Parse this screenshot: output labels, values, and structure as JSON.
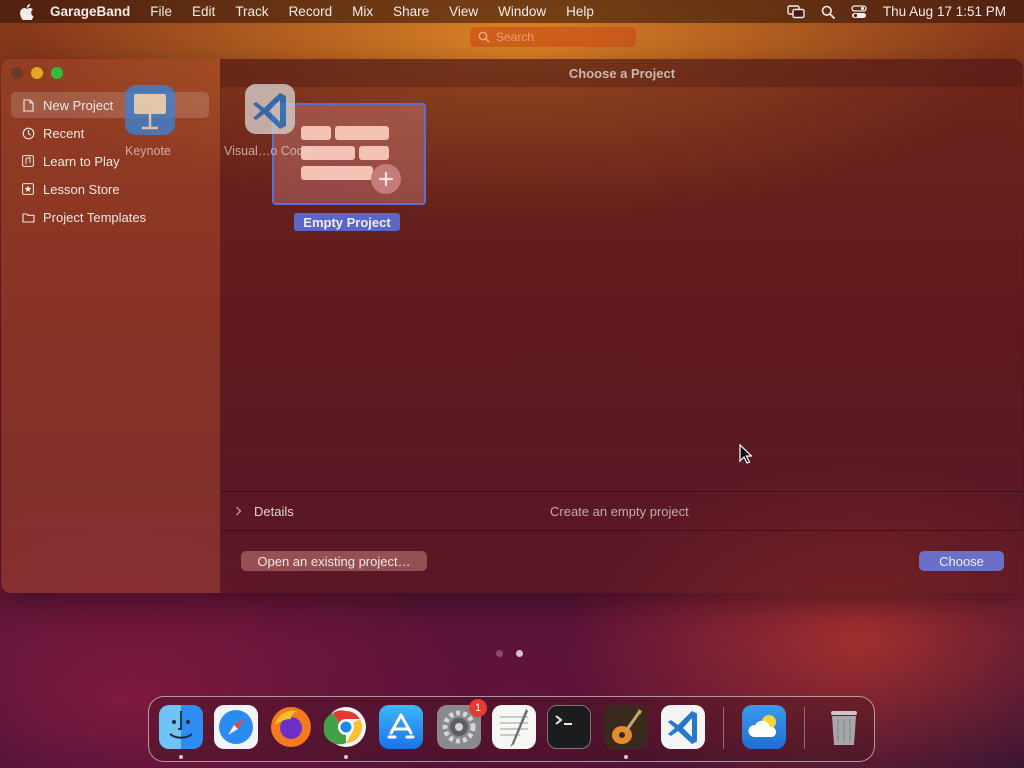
{
  "menubar": {
    "app_name": "GarageBand",
    "items": [
      "File",
      "Edit",
      "Track",
      "Record",
      "Mix",
      "Share",
      "View",
      "Window",
      "Help"
    ],
    "clock": "Thu Aug 17  1:51 PM",
    "status_icons": [
      "screen-mirroring-icon",
      "spotlight-search-icon",
      "control-center-icon"
    ]
  },
  "spotlight": {
    "placeholder": "Search"
  },
  "window": {
    "title": "Choose a Project",
    "sidebar": [
      {
        "label": "New Project",
        "icon": "document-icon",
        "selected": true
      },
      {
        "label": "Recent",
        "icon": "clock-icon",
        "selected": false
      },
      {
        "label": "Learn to Play",
        "icon": "music-note-icon",
        "selected": false
      },
      {
        "label": "Lesson Store",
        "icon": "star-icon",
        "selected": false
      },
      {
        "label": "Project Templates",
        "icon": "folder-icon",
        "selected": false
      }
    ],
    "templates": [
      {
        "label": "Empty Project",
        "selected": true
      }
    ],
    "details_label": "Details",
    "details_description": "Create an empty project",
    "open_button": "Open an existing project…",
    "choose_button": "Choose"
  },
  "ghost_icons": [
    {
      "label": "Keynote",
      "icon": "keynote-icon"
    },
    {
      "label": "Visual…o Code",
      "icon": "vscode-icon"
    }
  ],
  "dock": {
    "apps": [
      {
        "name": "Finder",
        "icon": "finder-icon",
        "running": true
      },
      {
        "name": "Safari",
        "icon": "safari-icon",
        "running": false
      },
      {
        "name": "Firefox",
        "icon": "firefox-icon",
        "running": false
      },
      {
        "name": "Chrome",
        "icon": "chrome-icon",
        "running": true
      },
      {
        "name": "App Store",
        "icon": "app-store-icon",
        "running": false
      },
      {
        "name": "System Settings",
        "icon": "settings-gear-icon",
        "running": false,
        "badge": "1"
      },
      {
        "name": "TextEdit",
        "icon": "textedit-icon",
        "running": false
      },
      {
        "name": "Terminal",
        "icon": "terminal-icon",
        "running": false
      },
      {
        "name": "GarageBand",
        "icon": "garageband-icon",
        "running": true
      },
      {
        "name": "Visual Studio Code",
        "icon": "vscode-icon",
        "running": false
      },
      {
        "name": "Weather",
        "icon": "weather-icon",
        "running": false
      },
      {
        "name": "Trash",
        "icon": "trash-icon",
        "running": false
      }
    ]
  },
  "colors": {
    "accent": "#5a67c9",
    "traffic_min": "#e3a823",
    "traffic_max": "#2fbd3a",
    "badge": "#e53a31"
  }
}
